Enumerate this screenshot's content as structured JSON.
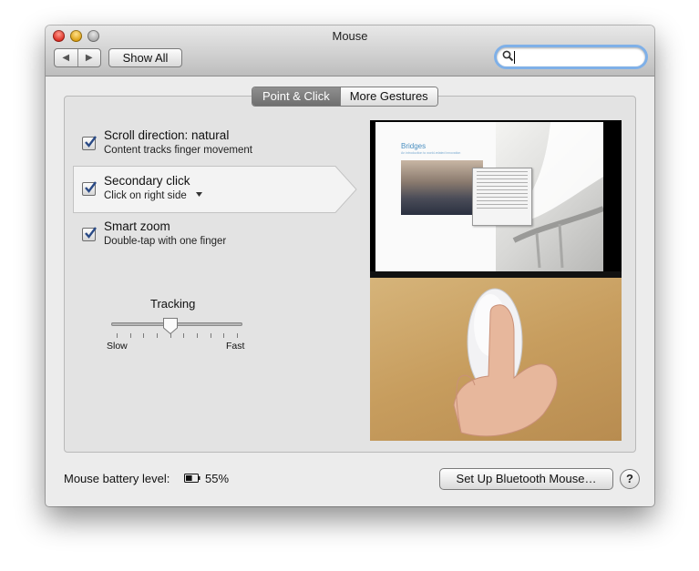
{
  "window": {
    "title": "Mouse",
    "back_glyph": "◀",
    "forward_glyph": "▶",
    "show_all_label": "Show All",
    "search_placeholder": "",
    "search_icon": "magnifying-glass-icon"
  },
  "tabs": [
    {
      "label": "Point & Click",
      "selected": true
    },
    {
      "label": "More Gestures",
      "selected": false
    }
  ],
  "options": [
    {
      "title": "Scroll direction: natural",
      "subtitle": "Content tracks finger movement",
      "checked": true
    },
    {
      "title": "Secondary click",
      "subtitle": "Click on right side",
      "checked": true,
      "has_menu": true,
      "selected": true
    },
    {
      "title": "Smart zoom",
      "subtitle": "Double-tap with one finger",
      "checked": true
    }
  ],
  "tracking": {
    "label": "Tracking",
    "min_label": "Slow",
    "max_label": "Fast",
    "value_fraction": 0.45,
    "tick_count": 10
  },
  "preview": {
    "doc_title": "Bridges",
    "doc_subtitle": "An introduction to world-related innovation"
  },
  "footer": {
    "battery_label": "Mouse battery level:",
    "battery_icon": "battery-icon",
    "battery_percent": "55%",
    "setup_button": "Set Up Bluetooth Mouse…",
    "help_label": "?"
  },
  "colors": {
    "checkbox_check": "#2a4a86",
    "search_focus": "#7fb0e8",
    "active_tab": "#7f7f7f"
  }
}
